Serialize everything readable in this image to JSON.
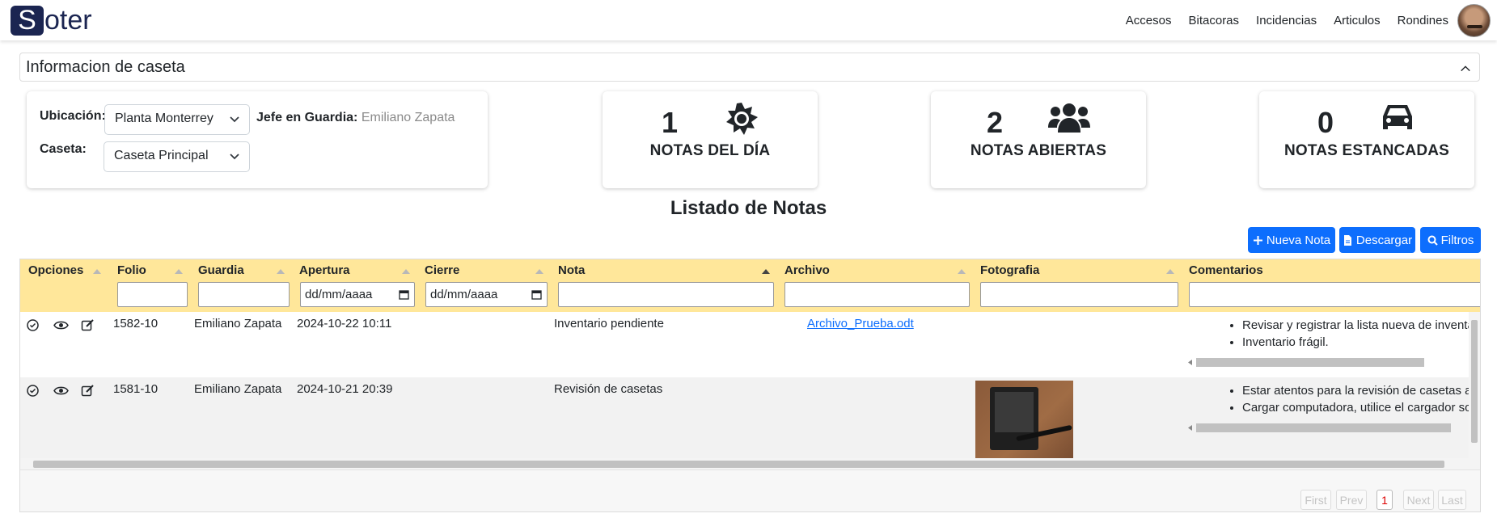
{
  "brand": {
    "letter": "S",
    "rest": "oter"
  },
  "nav": {
    "links": [
      "Accesos",
      "Bitacoras",
      "Incidencias",
      "Articulos",
      "Rondines"
    ]
  },
  "caseta": {
    "title": "Informacion de caseta",
    "ubicacion_label": "Ubicación:",
    "ubicacion_value": "Planta Monterrey",
    "caseta_label": "Caseta:",
    "caseta_value": "Caseta Principal",
    "jefe_label": "Jefe en Guardia:",
    "jefe_value": "Emiliano Zapata"
  },
  "stats": [
    {
      "value": "1",
      "label": "NOTAS DEL DÍA",
      "icon": "sun-icon"
    },
    {
      "value": "2",
      "label": "NOTAS ABIERTAS",
      "icon": "users-icon"
    },
    {
      "value": "0",
      "label": "NOTAS ESTANCADAS",
      "icon": "car-icon"
    }
  ],
  "list_title": "Listado de Notas",
  "buttons": {
    "nueva": "Nueva Nota",
    "descargar": "Descargar",
    "filtros": "Filtros"
  },
  "table": {
    "columns": [
      "Opciones",
      "Folio",
      "Guardia",
      "Apertura",
      "Cierre",
      "Nota",
      "Archivo",
      "Fotografia",
      "Comentarios"
    ],
    "date_placeholder": "dd/mm/aaaa",
    "rows": [
      {
        "folio": "1582-10",
        "guardia": "Emiliano Zapata",
        "apertura": "2024-10-22 10:11",
        "cierre": "",
        "nota": "Inventario pendiente",
        "archivo": "Archivo_Prueba.odt",
        "comentarios": [
          "Revisar y registrar la lista nueva de inventario para",
          "Inventario frágil."
        ]
      },
      {
        "folio": "1581-10",
        "guardia": "Emiliano Zapata",
        "apertura": "2024-10-21 20:39",
        "cierre": "",
        "nota": "Revisión de casetas",
        "archivo": "",
        "comentarios": [
          "Estar atentos para la revisión de casetas a partir de",
          "Cargar computadora, utilice el cargador sobre la m"
        ]
      }
    ]
  },
  "pagination": {
    "first": "First",
    "prev": "Prev",
    "current": "1",
    "next": "Next",
    "last": "Last"
  }
}
